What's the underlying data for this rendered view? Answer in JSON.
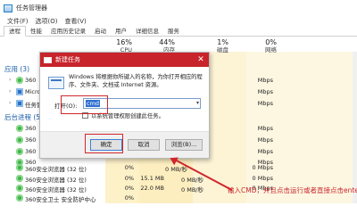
{
  "window": {
    "title": "任务管理器"
  },
  "menu": [
    "文件(F)",
    "选项(O)",
    "查看(V)"
  ],
  "tabs": [
    "进程",
    "性能",
    "应用历史记录",
    "启动",
    "用户",
    "详细信息",
    "服务"
  ],
  "columns": [
    {
      "pct": "",
      "label": ""
    },
    {
      "pct": "16%",
      "label": "CPU"
    },
    {
      "pct": "44%",
      "label": "内存"
    },
    {
      "pct": "1%",
      "label": "磁盘"
    },
    {
      "pct": "0%",
      "label": "网络"
    }
  ],
  "sections": {
    "apps": "应用 (3)",
    "background": "后台进程 (54)"
  },
  "processes": [
    {
      "name": "360",
      "cpu": "",
      "mem": "",
      "disk": "",
      "net": "Mbps"
    },
    {
      "name": "Micro",
      "cpu": "",
      "mem": "",
      "disk": "",
      "net": "Mbps"
    },
    {
      "name": "任务管",
      "cpu": "",
      "mem": "",
      "disk": "",
      "net": "Mbps"
    },
    {
      "name": "360",
      "cpu": "",
      "mem": "",
      "disk": "",
      "net": "Mbps"
    },
    {
      "name": "360",
      "cpu": "",
      "mem": "",
      "disk": "",
      "net": "Mbps"
    },
    {
      "name": "360",
      "cpu": "",
      "mem": "",
      "disk": "",
      "net": "Mbps"
    },
    {
      "name": "360",
      "cpu": "",
      "mem": "",
      "disk": "",
      "net": "Mbps"
    },
    {
      "name": "360安全浏览器 (32 位)",
      "cpu": "0%",
      "mem": "0 MB/秒",
      "disk": "",
      "net": "0 Mbps"
    },
    {
      "name": "360安全浏览器 (32 位)",
      "cpu": "0%",
      "mem": "15.1 MB",
      "disk": "0 MB/秒",
      "net": "0 Mbps"
    },
    {
      "name": "360安全浏览器 (32 位)",
      "cpu": "0%",
      "mem": "22.0 MB",
      "disk": "0 MB/秒",
      "net": "0 Mbps"
    },
    {
      "name": "360安全卫士 安全防护中心",
      "cpu": "0%",
      "mem": "",
      "disk": "",
      "net": ""
    }
  ],
  "run_dialog": {
    "title": "新建任务",
    "description": "Windows 将根据你所键入的名称，为你打开相应的程序、文件夹、文档或 Internet 资源。",
    "open_label": "打开(O):",
    "open_value": "cmd",
    "admin_label": "以系统管理权限创建此任务。",
    "ok_label": "确定",
    "cancel_label": "取消",
    "browse_label": "浏览(B)..."
  },
  "annotation": {
    "text": "输入CMD，并且点击运行或者直接点击enter"
  },
  "colors": {
    "title_bar": "#c8242b",
    "annotation": "#d1262c",
    "heat_column": "#fdf4cf"
  }
}
